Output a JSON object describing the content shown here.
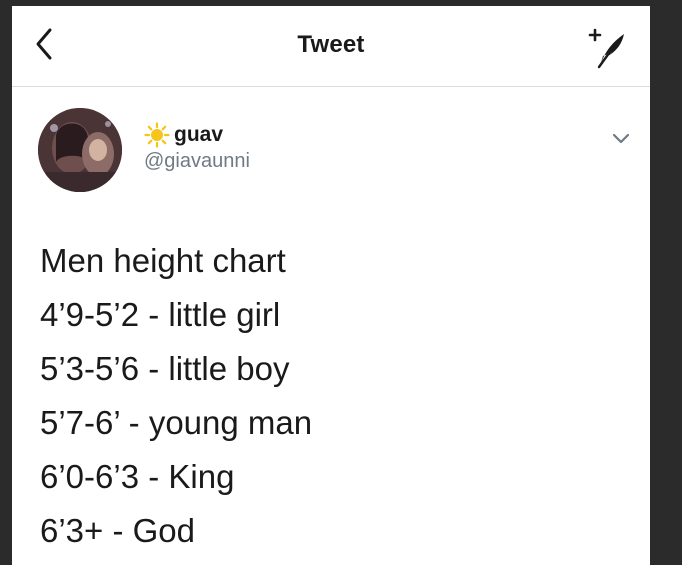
{
  "header": {
    "title": "Tweet",
    "back_icon": "chevron-left-icon",
    "compose_icon": "compose-quill-icon"
  },
  "tweet": {
    "author": {
      "display_name": "guav",
      "name_emoji": "sun-icon",
      "handle": "@giavaunni"
    },
    "menu_icon": "chevron-down-icon",
    "lines": [
      "Men height chart",
      "4’9-5’2 - little girl",
      "5’3-5’6 - little boy",
      "5’7-6’ - young man",
      "6’0-6’3 - King",
      "6’3+ - God"
    ]
  },
  "colors": {
    "background_frame": "#2b2b2b",
    "panel": "#ffffff",
    "text_primary": "#1a1a1a",
    "text_secondary": "#6f7a84",
    "divider": "#dcdcdc",
    "sun_yellow": "#f5c518"
  }
}
